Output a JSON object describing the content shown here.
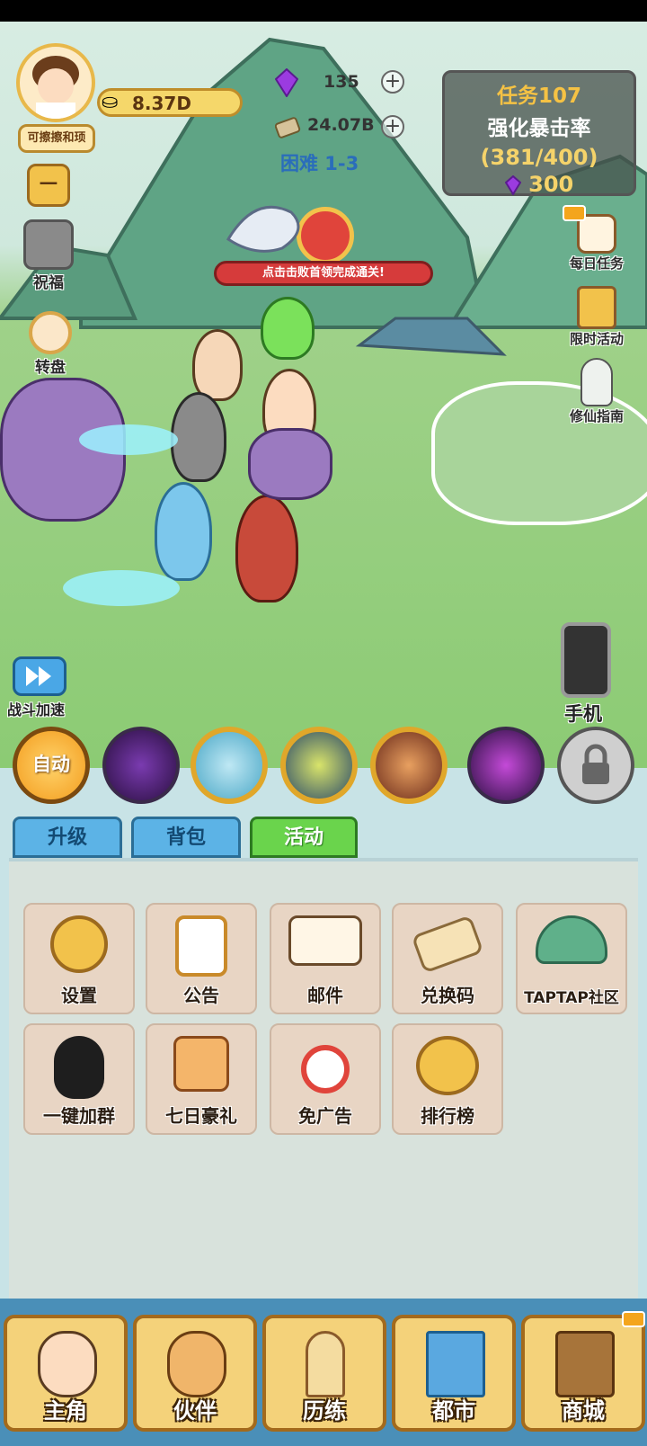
{
  "hud": {
    "player_name": "可擦擦和顼",
    "gold": "8.37D",
    "gems": "135",
    "cash": "24.07B",
    "stage": "困难 1-3"
  },
  "task": {
    "title": "任务107",
    "name": "强化暴击率",
    "progress": "(381/400)",
    "reward": "300"
  },
  "scene": {
    "boss_banner": "点击击败首领完成通关!",
    "left_icons": [
      {
        "label": "祝福",
        "icon": "blessing-icon"
      },
      {
        "label": "转盘",
        "icon": "wheel-icon"
      }
    ],
    "right_icons": [
      {
        "label": "每日任务",
        "icon": "daily-task-icon"
      },
      {
        "label": "限时活动",
        "icon": "limited-event-icon"
      },
      {
        "label": "修仙指南",
        "icon": "guide-icon"
      }
    ],
    "speed_label": "战斗加速",
    "phone_label": "手机"
  },
  "skills": {
    "auto_label": "自动"
  },
  "tabs": [
    {
      "label": "升级"
    },
    {
      "label": "背包"
    },
    {
      "label": "活动"
    }
  ],
  "activities": [
    {
      "label": "设置",
      "icon": "gear-icon"
    },
    {
      "label": "公告",
      "icon": "clipboard-icon"
    },
    {
      "label": "邮件",
      "icon": "mail-icon"
    },
    {
      "label": "兑换码",
      "icon": "ticket-icon"
    },
    {
      "label": "TAPTAP社区",
      "icon": "taptap-icon"
    },
    {
      "label": "一键加群",
      "icon": "qq-penguin-icon"
    },
    {
      "label": "七日豪礼",
      "icon": "scroll-icon"
    },
    {
      "label": "免广告",
      "icon": "no-ads-icon"
    },
    {
      "label": "排行榜",
      "icon": "trophy-icon"
    }
  ],
  "nav": [
    {
      "label": "主角"
    },
    {
      "label": "伙伴"
    },
    {
      "label": "历练"
    },
    {
      "label": "都市"
    },
    {
      "label": "商城"
    }
  ],
  "colors": {
    "tab_active": "#6ad44c",
    "tab_inactive": "#5cb3e6",
    "nav_bg": "#4a8fb8",
    "gold_accent": "#f2c24b"
  }
}
